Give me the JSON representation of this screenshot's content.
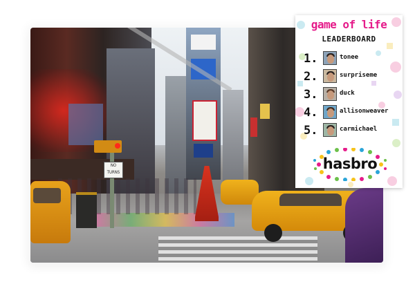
{
  "photo": {
    "sign_no_turns": "NO TURNS",
    "taxi_text": "TAXI"
  },
  "leaderboard": {
    "title": "game of life",
    "subtitle": "LEADERBOARD",
    "entries": [
      {
        "rank": "1.",
        "name": "tonee"
      },
      {
        "rank": "2.",
        "name": "surpriseme"
      },
      {
        "rank": "3.",
        "name": "duck"
      },
      {
        "rank": "4.",
        "name": "allisonweaver"
      },
      {
        "rank": "5.",
        "name": "carmichael"
      }
    ],
    "brand": "hasbro"
  },
  "colors": {
    "title_pink": "#e51b8a",
    "confetti": [
      "#f3a7c9",
      "#9fd9e6",
      "#f6e08a",
      "#bfe39b",
      "#d7b6e8"
    ]
  }
}
